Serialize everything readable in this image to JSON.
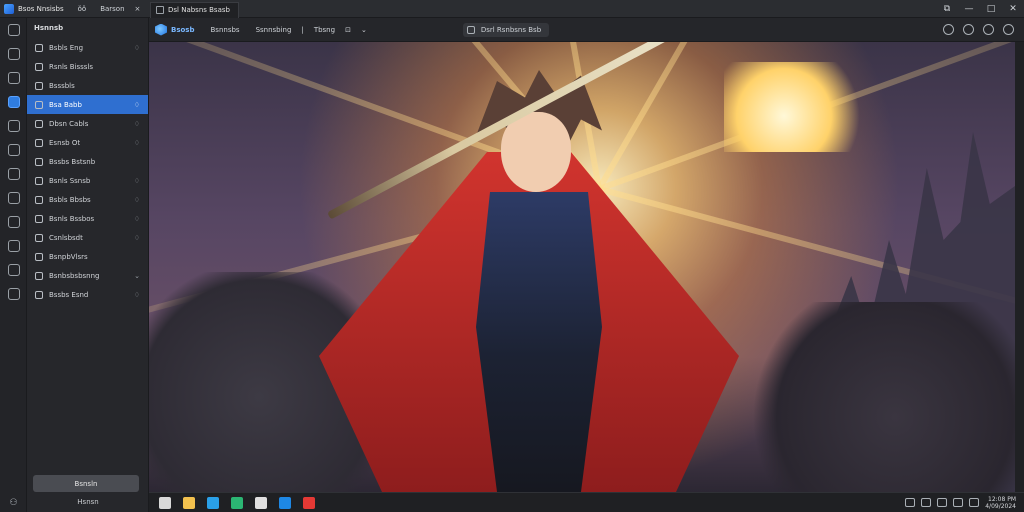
{
  "titlebar": {
    "app_title": "Bsos Nnsisbs",
    "menu_1": "ŏŏ",
    "menu_2": "Barson",
    "menu_x": "×",
    "tab_label": "Dsl Nabsns Bsasb",
    "window_controls": [
      "⧉",
      "—",
      "□",
      "✕"
    ]
  },
  "rail": {
    "items": [
      {
        "icon": "image-icon",
        "active": false
      },
      {
        "icon": "layers-icon",
        "active": false
      },
      {
        "icon": "monitor-icon",
        "active": false
      },
      {
        "icon": "shield-icon",
        "active": true
      },
      {
        "icon": "compass-icon",
        "active": false
      },
      {
        "icon": "folder-icon",
        "active": false
      },
      {
        "icon": "grid-icon",
        "active": false
      },
      {
        "icon": "chat-icon",
        "active": false
      },
      {
        "icon": "settings-icon",
        "active": false
      },
      {
        "icon": "heart-icon",
        "active": false
      },
      {
        "icon": "palette-icon",
        "active": false
      },
      {
        "icon": "brush-icon",
        "active": false
      }
    ],
    "bottom_icon": "user-icon",
    "bottom_glyph": "⚇"
  },
  "sidebar": {
    "header": "Hsnnsb",
    "items": [
      {
        "label": "Bsbls Eng",
        "tail": "♢",
        "active": false
      },
      {
        "label": "Rsnls Bisssls",
        "tail": "",
        "active": false
      },
      {
        "label": "Bsssbls",
        "tail": "",
        "active": false
      },
      {
        "label": "Bsa Babb",
        "tail": "♢",
        "active": true
      },
      {
        "label": "Dbsn Cabls",
        "tail": "♢",
        "active": false
      },
      {
        "label": "Esnsb Ot",
        "tail": "♢",
        "active": false
      },
      {
        "label": "Bssbs Bstsnb",
        "tail": "",
        "active": false
      },
      {
        "label": "Bsnls Ssnsb",
        "tail": "♢",
        "active": false
      },
      {
        "label": "Bsbls Bbsbs",
        "tail": "♢",
        "active": false
      },
      {
        "label": "Bsnls Bssbos",
        "tail": "♢",
        "active": false
      },
      {
        "label": "Csnlsbsdt",
        "tail": "♢",
        "active": false
      },
      {
        "label": "BsnpbVlsrs",
        "tail": "",
        "active": false
      },
      {
        "label": "Bsnbsbsbsnng",
        "tail": "⌄",
        "active": false
      },
      {
        "label": "Bssbs Esnd",
        "tail": "♢",
        "active": false
      }
    ],
    "button_label": "Bsnsln",
    "footer_label": "Hsnsn"
  },
  "toolbar": {
    "brand": "Bsosb",
    "items": [
      "Bsnnsbs",
      "Ssnnsbing",
      "Tbsng"
    ],
    "sep": "|",
    "small_icons": [
      "⊡",
      "⌄"
    ],
    "search_label": "Dsrl Rsnbsns Bsb",
    "right_icons": [
      "help-icon",
      "info-icon",
      "user-circle-icon",
      "settings-circle-icon"
    ]
  },
  "taskbar": {
    "icons": [
      {
        "name": "file-icon",
        "color": "#d9d9d9"
      },
      {
        "name": "folder-icon",
        "color": "#f2c14e"
      },
      {
        "name": "mail-icon",
        "color": "#2aa0e8"
      },
      {
        "name": "browser-icon",
        "color": "#2bb673"
      },
      {
        "name": "media-icon",
        "color": "#e0e0e0"
      },
      {
        "name": "shield-app-icon",
        "color": "#1e88e5"
      },
      {
        "name": "game-icon",
        "color": "#e53935"
      }
    ],
    "tray_icons": [
      "clock-icon",
      "network-icon",
      "battery-icon",
      "volume-icon",
      "keyboard-icon"
    ],
    "clock_line1": "12:08 PM",
    "clock_line2": "4/09/2024"
  },
  "colors": {
    "accent": "#2f6fd0",
    "background": "#202124",
    "panel": "#26272b"
  }
}
